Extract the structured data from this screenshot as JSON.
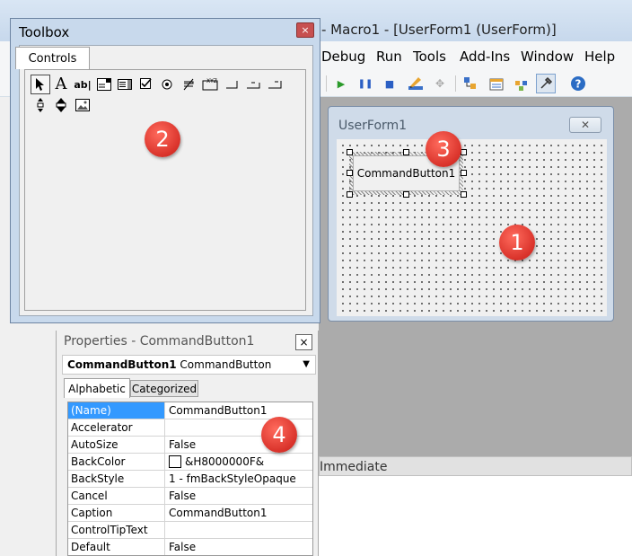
{
  "main_window": {
    "title": "- Macro1 - [UserForm1 (UserForm)]",
    "menu": [
      "Debug",
      "Run",
      "Tools",
      "Add-Ins",
      "Window",
      "Help"
    ],
    "toolbar_icons": [
      "run-icon",
      "break-icon",
      "reset-icon",
      "design-mode-icon",
      "unknown-icon",
      "project-explorer-icon",
      "properties-window-icon",
      "object-browser-icon",
      "toolbox-icon",
      "help-icon"
    ]
  },
  "toolbox": {
    "title": "Toolbox",
    "close": "×",
    "tab": "Controls",
    "tools": [
      "select-objects",
      "label",
      "textbox",
      "combobox",
      "listbox",
      "checkbox",
      "optionbutton",
      "togglebutton",
      "frame",
      "commandbutton",
      "tabstrip",
      "multipage",
      "scrollbar",
      "spinbutton",
      "image"
    ],
    "tool_glyphs": {
      "label": "A",
      "textbox": "ab|"
    }
  },
  "userform": {
    "title": "UserForm1",
    "close": "✕",
    "button_caption": "CommandButton1"
  },
  "immediate": {
    "title": "Immediate"
  },
  "properties": {
    "title": "Properties - CommandButton1",
    "close": "×",
    "object_name": "CommandButton1",
    "object_type": "CommandButton",
    "tabs": [
      "Alphabetic",
      "Categorized"
    ],
    "rows": [
      {
        "name": "(Name)",
        "value": "CommandButton1"
      },
      {
        "name": "Accelerator",
        "value": ""
      },
      {
        "name": "AutoSize",
        "value": "False"
      },
      {
        "name": "BackColor",
        "value": "&H8000000F&"
      },
      {
        "name": "BackStyle",
        "value": "1 - fmBackStyleOpaque"
      },
      {
        "name": "Cancel",
        "value": "False"
      },
      {
        "name": "Caption",
        "value": "CommandButton1"
      },
      {
        "name": "ControlTipText",
        "value": ""
      },
      {
        "name": "Default",
        "value": "False"
      }
    ]
  },
  "callouts": [
    "1",
    "2",
    "3",
    "4"
  ],
  "colors": {
    "callout": "#d9322a",
    "selection": "#3399ff",
    "toolbox_frame": "#c8d9ec"
  }
}
